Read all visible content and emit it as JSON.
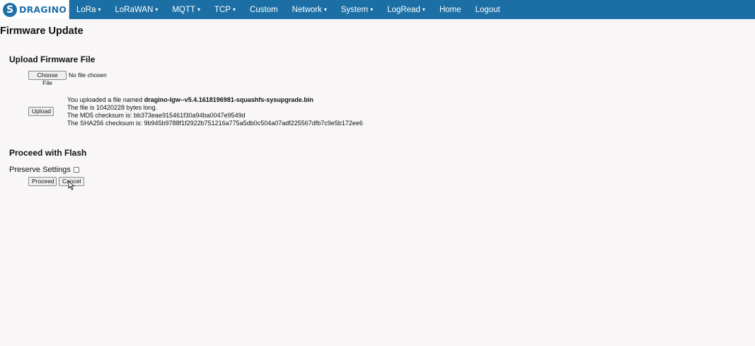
{
  "brand": {
    "logo_text": "DRAGINO",
    "logo_mark": "S"
  },
  "nav": {
    "items": [
      {
        "label": "LoRa",
        "dropdown": true
      },
      {
        "label": "LoRaWAN",
        "dropdown": true
      },
      {
        "label": "MQTT",
        "dropdown": true
      },
      {
        "label": "TCP",
        "dropdown": true
      },
      {
        "label": "Custom",
        "dropdown": false
      },
      {
        "label": "Network",
        "dropdown": true
      },
      {
        "label": "System",
        "dropdown": true
      },
      {
        "label": "LogRead",
        "dropdown": true
      },
      {
        "label": "Home",
        "dropdown": false
      },
      {
        "label": "Logout",
        "dropdown": false
      }
    ],
    "caret": "▾"
  },
  "page": {
    "title": "Firmware Update"
  },
  "upload_section": {
    "title": "Upload Firmware File",
    "choose_file_label": "Choose File",
    "no_file_text": "No file chosen",
    "upload_label": "Upload",
    "info": {
      "line1_prefix": "You uploaded a file named ",
      "file_name": "dragino-lgw--v5.4.1618196981-squashfs-sysupgrade.bin",
      "line2": "The file is 10420228 bytes long.",
      "line3": "The MD5 checksum is: bb373eae915461f30a94ba0047e9549d",
      "line4": "The SHA256 checksum is: 9b945b9788f1f2922b751216a775a5db0c504a07adf225567dfb7c9e5b172ee6"
    }
  },
  "flash_section": {
    "title": "Proceed with Flash",
    "preserve_label": "Preserve Settings",
    "preserve_checked": false,
    "proceed_label": "Proceed",
    "cancel_label": "Cancel"
  },
  "colors": {
    "navbar": "#1b6fa5",
    "background": "#f8f6f7",
    "logo_text": "#1f6fa8"
  }
}
